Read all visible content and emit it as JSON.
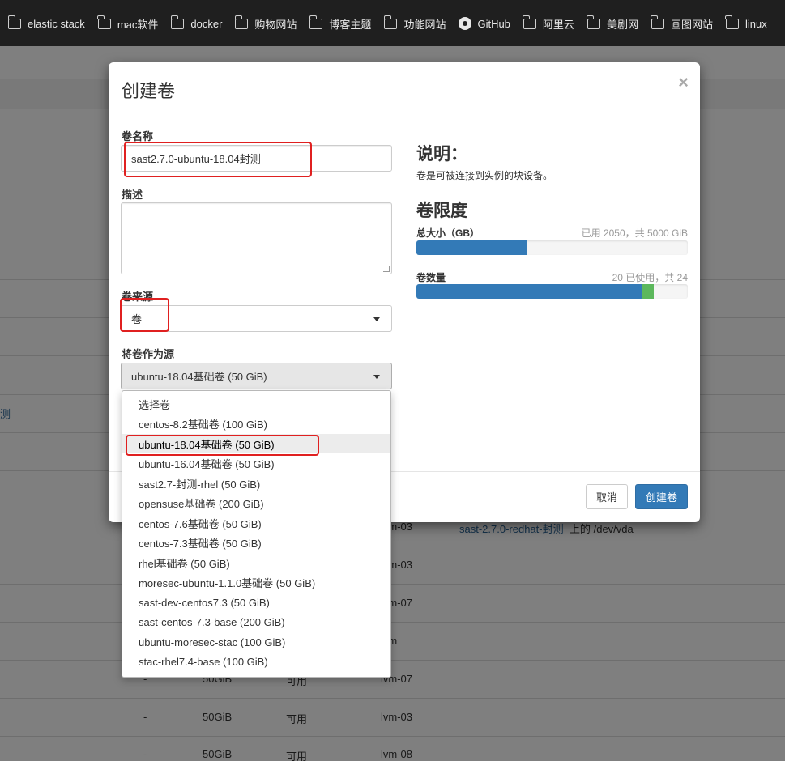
{
  "bookmarks": [
    {
      "label": "elastic stack",
      "icon": "folder-icon"
    },
    {
      "label": "mac软件",
      "icon": "folder-icon"
    },
    {
      "label": "docker",
      "icon": "folder-icon"
    },
    {
      "label": "购物网站",
      "icon": "folder-icon"
    },
    {
      "label": "博客主题",
      "icon": "folder-icon"
    },
    {
      "label": "功能网站",
      "icon": "folder-icon"
    },
    {
      "label": "GitHub",
      "icon": "github-icon"
    },
    {
      "label": "阿里云",
      "icon": "folder-icon"
    },
    {
      "label": "美剧网",
      "icon": "folder-icon"
    },
    {
      "label": "画图网站",
      "icon": "folder-icon"
    },
    {
      "label": "linux",
      "icon": "folder-icon"
    }
  ],
  "background_table": {
    "left_fragment": "测",
    "row1": {
      "host": "lvm-03",
      "attached_to": "sast-2.7.0-redhat-封测",
      "attached_suffix": "上的 /dev/vda"
    },
    "row2_host": "lvm-03",
    "row3_host": "lvm-07",
    "row4_host": "lvm",
    "row5": {
      "dash": "-",
      "size": "50GiB",
      "status": "可用",
      "host": "lvm-07"
    },
    "row6": {
      "dash": "-",
      "size": "50GiB",
      "status": "可用",
      "host": "lvm-03"
    },
    "row7": {
      "dash": "-",
      "size": "50GiB",
      "status": "可用",
      "host": "lvm-08"
    }
  },
  "modal": {
    "title": "创建卷",
    "close_label": "×",
    "volume_name": {
      "label": "卷名称",
      "value": "sast2.7.0-ubuntu-18.04封测"
    },
    "description": {
      "label": "描述",
      "value": ""
    },
    "volume_source": {
      "label": "卷来源",
      "value": "卷"
    },
    "source_volume": {
      "label": "将卷作为源",
      "value": "ubuntu-18.04基础卷 (50 GiB)"
    },
    "info": {
      "heading": "说明：",
      "text": "卷是可被连接到实例的块设备。",
      "limits_heading": "卷限度",
      "total_size_label": "总大小（GB）",
      "total_size_usage": "已用 2050，共 5000 GiB",
      "total_used": 2050,
      "total_max": 5000,
      "count_label": "卷数量",
      "count_usage": "20 已使用，共 24",
      "count_used": 20,
      "count_adding": 1,
      "count_max": 24
    },
    "cancel_label": "取消",
    "submit_label": "创建卷"
  },
  "dropdown_options": [
    "选择卷",
    "centos-8.2基础卷 (100 GiB)",
    "ubuntu-18.04基础卷 (50 GiB)",
    "ubuntu-16.04基础卷 (50 GiB)",
    "sast2.7-封测-rhel (50 GiB)",
    "opensuse基础卷 (200 GiB)",
    "centos-7.6基础卷 (50 GiB)",
    "centos-7.3基础卷 (50 GiB)",
    "rhel基础卷 (50 GiB)",
    "moresec-ubuntu-1.1.0基础卷 (50 GiB)",
    "sast-dev-centos7.3 (50 GiB)",
    "sast-centos-7.3-base (200 GiB)",
    "ubuntu-moresec-stac (100 GiB)",
    "stac-rhel7.4-base (100 GiB)"
  ],
  "selected_option_index": 2,
  "colors": {
    "primary": "#337ab7",
    "progress_used": "#337ab7",
    "progress_adding": "#5cb85c",
    "highlight": "#e02020"
  }
}
